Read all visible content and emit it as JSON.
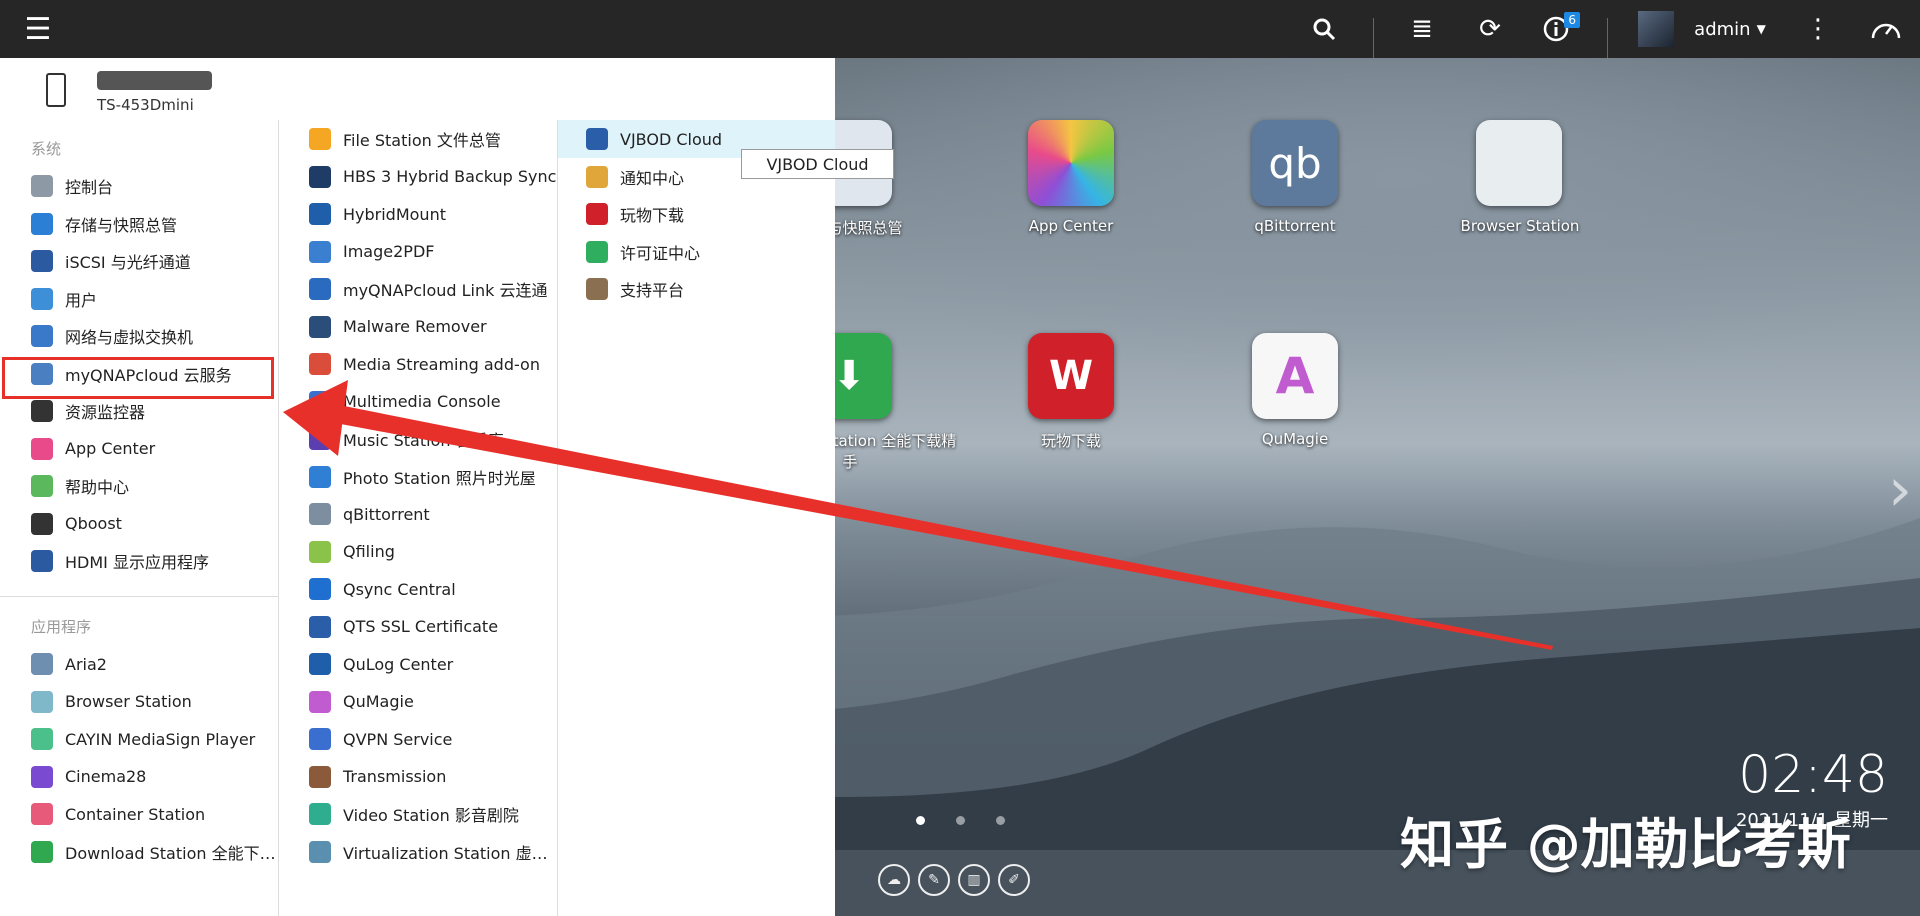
{
  "topbar": {
    "user": "admin",
    "notification_count": "6"
  },
  "device": {
    "model": "TS-453Dmini"
  },
  "sections": {
    "system": "系统",
    "apps": "应用程序"
  },
  "system_items": [
    {
      "label": "控制台",
      "icon": "gear-icon",
      "color": "#8d9aa6"
    },
    {
      "label": "存储与快照总管",
      "icon": "storage-icon",
      "color": "#2b7fd4"
    },
    {
      "label": "iSCSI 与光纤通道",
      "icon": "iscsi-icon",
      "color": "#2c5aa0"
    },
    {
      "label": "用户",
      "icon": "user-icon",
      "color": "#3d8fd8"
    },
    {
      "label": "网络与虚拟交换机",
      "icon": "network-icon",
      "color": "#3a79c9"
    },
    {
      "label": "myQNAPcloud 云服务",
      "icon": "cloud-icon",
      "color": "#4a7fc1"
    },
    {
      "label": "资源监控器",
      "icon": "monitor-icon",
      "color": "#333333"
    },
    {
      "label": "App Center",
      "icon": "app-center-icon",
      "color": "#e94b8a"
    },
    {
      "label": "帮助中心",
      "icon": "help-icon",
      "color": "#5cb85c"
    },
    {
      "label": "Qboost",
      "icon": "qboost-icon",
      "color": "#333333"
    },
    {
      "label": "HDMI 显示应用程序",
      "icon": "hdmi-icon",
      "color": "#2c5aa0"
    }
  ],
  "app_items": [
    {
      "label": "Aria2",
      "icon": "aria2-icon",
      "color": "#6f8fb0"
    },
    {
      "label": "Browser Station",
      "icon": "browser-station-icon",
      "color": "#7fb8c9"
    },
    {
      "label": "CAYIN MediaSign Player",
      "icon": "cayin-icon",
      "color": "#4cc08a"
    },
    {
      "label": "Cinema28",
      "icon": "cinema-icon",
      "color": "#7a4bd0"
    },
    {
      "label": "Container Station",
      "icon": "container-icon",
      "color": "#e85a7a"
    },
    {
      "label": "Download Station 全能下…",
      "icon": "download-icon",
      "color": "#2fa84f"
    }
  ],
  "col2_items": [
    {
      "label": "File Station 文件总管",
      "icon": "folder-icon",
      "color": "#f5a623"
    },
    {
      "label": "HBS 3 Hybrid Backup Sync",
      "icon": "hbs-icon",
      "color": "#1f3c66"
    },
    {
      "label": "HybridMount",
      "icon": "hybridmount-icon",
      "color": "#1f5ea8"
    },
    {
      "label": "Image2PDF",
      "icon": "pdf-icon",
      "color": "#3a7fd0"
    },
    {
      "label": "myQNAPcloud Link 云连通",
      "icon": "cloud-link-icon",
      "color": "#2a6bc0"
    },
    {
      "label": "Malware Remover",
      "icon": "shield-icon",
      "color": "#2a4d7a"
    },
    {
      "label": "Media Streaming add-on",
      "icon": "media-icon",
      "color": "#d94d3a"
    },
    {
      "label": "Multimedia Console",
      "icon": "multimedia-icon",
      "color": "#3a6fd0"
    },
    {
      "label": "Music Station 音乐库",
      "icon": "music-icon",
      "color": "#5b3fb0"
    },
    {
      "label": "Photo Station 照片时光屋",
      "icon": "photo-icon",
      "color": "#2f7fd4"
    },
    {
      "label": "qBittorrent",
      "icon": "qbittorrent-icon",
      "color": "#7c8ea0"
    },
    {
      "label": "Qfiling",
      "icon": "qfiling-icon",
      "color": "#8bc34a"
    },
    {
      "label": "Qsync Central",
      "icon": "sync-icon",
      "color": "#1e6fd0"
    },
    {
      "label": "QTS SSL Certificate",
      "icon": "certificate-icon",
      "color": "#2a5ea8"
    },
    {
      "label": "QuLog Center",
      "icon": "log-icon",
      "color": "#1f5ea8"
    },
    {
      "label": "QuMagie",
      "icon": "qumagie-icon",
      "color": "#c05bd0"
    },
    {
      "label": "QVPN Service",
      "icon": "vpn-icon",
      "color": "#3a6fd0"
    },
    {
      "label": "Transmission",
      "icon": "transmission-icon",
      "color": "#8a5a3a"
    },
    {
      "label": "Video Station 影音剧院",
      "icon": "video-icon",
      "color": "#2fae8f"
    },
    {
      "label": "Virtualization Station 虚…",
      "icon": "virtualization-icon",
      "color": "#5a8fb0"
    }
  ],
  "col3_items": [
    {
      "label": "VJBOD Cloud",
      "icon": "vjbod-icon",
      "color": "#2a5ea8"
    },
    {
      "label": "通知中心",
      "icon": "bell-icon",
      "color": "#e0a63a"
    },
    {
      "label": "玩物下载",
      "icon": "wanwu-icon",
      "color": "#d0202a"
    },
    {
      "label": "许可证中心",
      "icon": "license-icon",
      "color": "#2fae5f"
    },
    {
      "label": "支持平台",
      "icon": "support-icon",
      "color": "#8a7050"
    }
  ],
  "tooltip": "VJBOD Cloud",
  "desktop_icons": [
    {
      "label": "存储与快照总管",
      "icon": "storage-icon"
    },
    {
      "label": "App Center",
      "icon": "app-center-icon"
    },
    {
      "label": "qBittorrent",
      "icon": "qbittorrent-icon"
    },
    {
      "label": "Browser Station",
      "icon": "browser-station-icon"
    },
    {
      "label": "Download Station 全能下载精手",
      "icon": "download-icon"
    },
    {
      "label": "玩物下载",
      "icon": "wanwu-icon"
    },
    {
      "label": "QuMagie",
      "icon": "qumagie-icon"
    }
  ],
  "clock": {
    "time": "02:48",
    "date": "2021/11/1 星期一"
  },
  "watermark": "知乎 @加勒比考斯",
  "colors": {
    "topbar": "#262626",
    "highlight": "#dff4fa",
    "annotation_red": "#e8302a"
  }
}
